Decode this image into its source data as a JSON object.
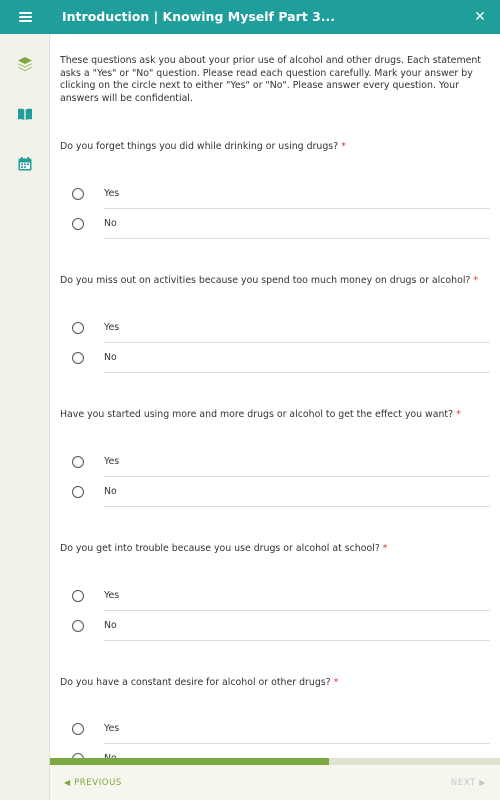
{
  "header": {
    "title": "Introduction | Knowing Myself Part 3...",
    "menu_icon": "hamburger-icon",
    "close_label": "✕"
  },
  "sidebar": {
    "items": [
      {
        "icon": "layers-icon",
        "color": "#7ba83f"
      },
      {
        "icon": "book-icon",
        "color": "#1f9e9b"
      },
      {
        "icon": "calendar-icon",
        "color": "#1f9e9b"
      }
    ]
  },
  "intro": "These questions ask you about your prior use of alcohol and other drugs. Each statement asks a \"Yes\" or \"No\" question. Please read each question carefully. Mark your answer by clicking on the circle next to either \"Yes\" or \"No\". Please answer every question. Your answers will be confidential.",
  "required_marker": "*",
  "questions": [
    {
      "text": "Do you forget things you did while drinking or using drugs?",
      "options": [
        "Yes",
        "No"
      ]
    },
    {
      "text": "Do you miss out on activities because you spend too much money on drugs or alcohol?",
      "options": [
        "Yes",
        "No"
      ]
    },
    {
      "text": "Have you started using more and more drugs or alcohol to get the effect you want?",
      "options": [
        "Yes",
        "No"
      ]
    },
    {
      "text": "Do you get into trouble because you use drugs or alcohol at school?",
      "options": [
        "Yes",
        "No"
      ]
    },
    {
      "text": "Do you have a constant desire for alcohol or other drugs?",
      "options": [
        "Yes",
        "No"
      ]
    }
  ],
  "progress": {
    "fraction": 0.62
  },
  "footer": {
    "prev_label": "PREVIOUS",
    "next_label": "NEXT"
  },
  "colors": {
    "header_bg": "#1f9e9b",
    "accent_green": "#7ba83f",
    "required": "#d9382e"
  }
}
